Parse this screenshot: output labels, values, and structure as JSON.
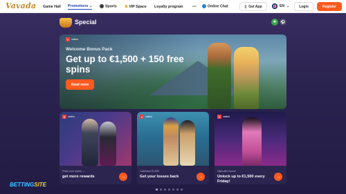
{
  "brand": {
    "logo_text": "Vavada"
  },
  "nav": {
    "items": [
      "Game Hall",
      "Promotions",
      "Sports",
      "VIP Space",
      "Loyalty program"
    ],
    "more": "•••",
    "online_chat": "Online Chat",
    "get_app": "Get App",
    "language": "EN",
    "login": "Login",
    "register": "Register"
  },
  "section": {
    "title": "Special"
  },
  "hero": {
    "badge": "casino",
    "subtitle": "Welcome Bonus Pack",
    "title": "Get up to €1,500 + 150 free spins",
    "button": "Read more"
  },
  "cards": [
    {
      "badge": "casino",
      "small": "Raise your status —",
      "main": "get more rewards"
    },
    {
      "badge": "casino",
      "small": "Cashback €1,800",
      "main": "Get your losses back"
    },
    {
      "badge": "casino",
      "small": "Highroller Bonus",
      "main": "Unlock up to €1,500 every Friday!"
    }
  ],
  "watermark": {
    "part1": "BETTING",
    "part2": "SITE"
  },
  "colors": {
    "accent": "#ff5a1f",
    "active_nav": "#1c3fb5",
    "background": "#2b2350"
  }
}
